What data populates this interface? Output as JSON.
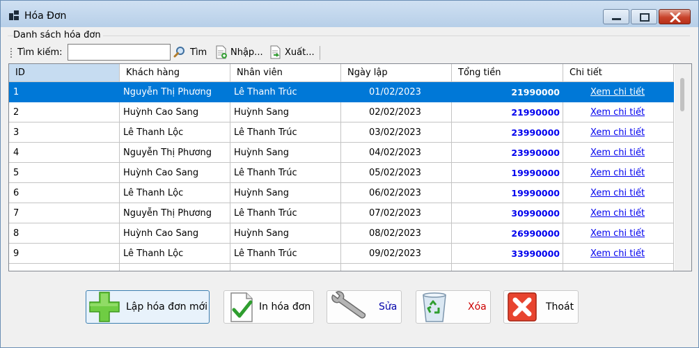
{
  "window": {
    "title": "Hóa Đơn",
    "controls": {
      "minimize": "minimize",
      "maximize": "maximize",
      "close": "close"
    }
  },
  "group": {
    "label": "Danh sách hóa đơn"
  },
  "toolbar": {
    "search_label": "Tìm kiếm:",
    "search_value": "",
    "find_label": "Tìm",
    "import_label": "Nhập...",
    "export_label": "Xuất..."
  },
  "table": {
    "columns": [
      "ID",
      "Khách hàng",
      "Nhân viên",
      "Ngày lập",
      "Tổng tiền",
      "Chi tiết"
    ],
    "rows": [
      {
        "id": "1",
        "customer": "Nguyễn Thị Phương",
        "employee": "Lê Thanh Trúc",
        "date": "01/02/2023",
        "total": "21990000",
        "detail": "Xem chi tiết"
      },
      {
        "id": "2",
        "customer": "Huỳnh Cao Sang",
        "employee": "Huỳnh Sang",
        "date": "02/02/2023",
        "total": "21990000",
        "detail": "Xem chi tiết"
      },
      {
        "id": "3",
        "customer": "Lê Thanh Lộc",
        "employee": "Lê Thanh Trúc",
        "date": "03/02/2023",
        "total": "23990000",
        "detail": "Xem chi tiết"
      },
      {
        "id": "4",
        "customer": "Nguyễn Thị Phương",
        "employee": "Huỳnh Sang",
        "date": "04/02/2023",
        "total": "23990000",
        "detail": "Xem chi tiết"
      },
      {
        "id": "5",
        "customer": "Huỳnh Cao Sang",
        "employee": "Lê Thanh Trúc",
        "date": "05/02/2023",
        "total": "19990000",
        "detail": "Xem chi tiết"
      },
      {
        "id": "6",
        "customer": "Lê Thanh Lộc",
        "employee": "Huỳnh Sang",
        "date": "06/02/2023",
        "total": "19990000",
        "detail": "Xem chi tiết"
      },
      {
        "id": "7",
        "customer": "Nguyễn Thị Phương",
        "employee": "Lê Thanh Trúc",
        "date": "07/02/2023",
        "total": "30990000",
        "detail": "Xem chi tiết"
      },
      {
        "id": "8",
        "customer": "Huỳnh Cao Sang",
        "employee": "Huỳnh Sang",
        "date": "08/02/2023",
        "total": "26990000",
        "detail": "Xem chi tiết"
      },
      {
        "id": "9",
        "customer": "Lê Thanh Lộc",
        "employee": "Lê Thanh Trúc",
        "date": "09/02/2023",
        "total": "33990000",
        "detail": "Xem chi tiết"
      },
      {
        "id": "",
        "customer": "",
        "employee": "",
        "date": "",
        "total": "",
        "detail": ""
      }
    ],
    "selected_row": 1
  },
  "actions": {
    "new_label": "Lập hóa đơn mới",
    "print_label": "In hóa đơn",
    "edit_label": "Sửa",
    "delete_label": "Xóa",
    "exit_label": "Thoát"
  },
  "icons": {
    "app": "app-window-icon",
    "find": "magnifier-icon",
    "import": "import-document-icon",
    "export": "export-document-icon",
    "new": "green-plus-icon",
    "print": "document-check-icon",
    "edit": "wrench-icon",
    "delete": "recycle-bin-icon",
    "exit": "red-x-icon"
  },
  "colors": {
    "selection": "#0078d7",
    "money": "#0000ee",
    "link": "#0000ee",
    "delete_text": "#cc0000",
    "edit_text": "#0000aa"
  }
}
